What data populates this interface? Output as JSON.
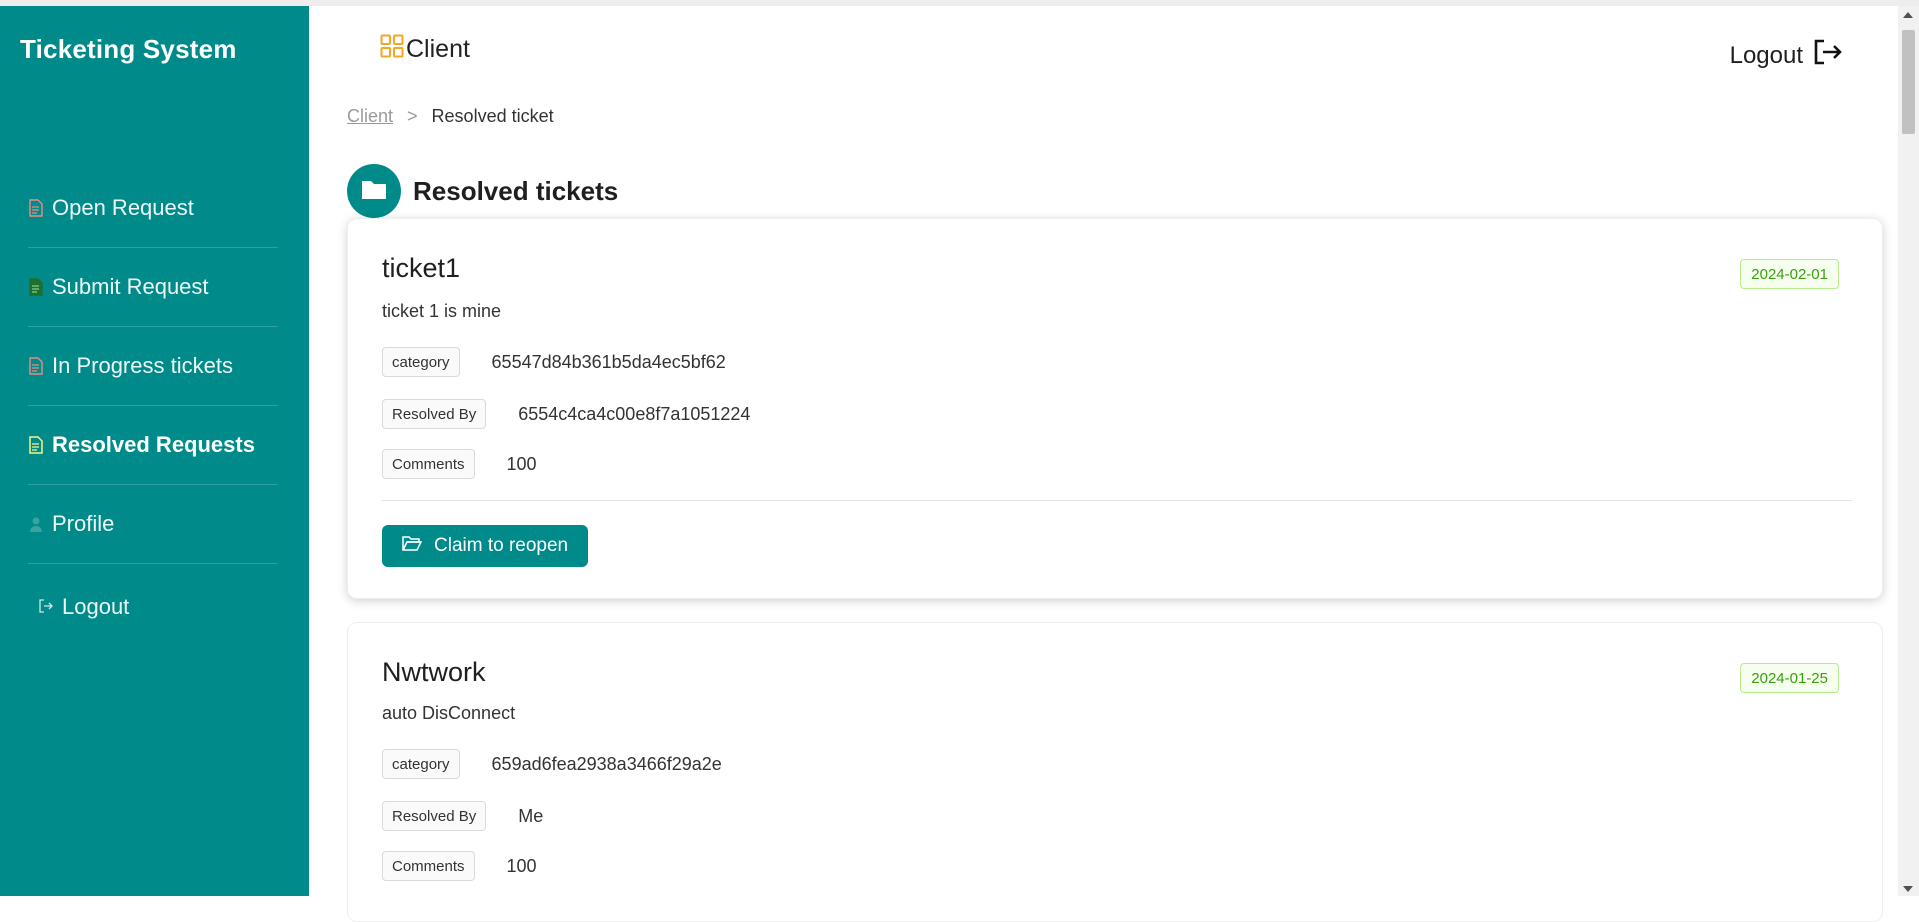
{
  "app": {
    "brand": "Ticketing System"
  },
  "sidebar": {
    "items": [
      {
        "label": "Open Request",
        "icon": "document-icon",
        "icon_color": "#e88b85"
      },
      {
        "label": "Submit Request",
        "icon": "document-icon",
        "icon_color": "#1f6f2e"
      },
      {
        "label": "In Progress tickets",
        "icon": "document-icon",
        "icon_color": "#e88b85"
      },
      {
        "label": "Resolved Requests",
        "icon": "document-icon",
        "icon_color": "#f7f48b",
        "active": true
      },
      {
        "label": "Profile",
        "icon": "user-icon",
        "icon_color": "#3aa3a2"
      }
    ],
    "logout_label": "Logout"
  },
  "header": {
    "role_label": "Client",
    "logout_label": "Logout"
  },
  "breadcrumb": {
    "root": "Client",
    "separator": ">",
    "current": "Resolved ticket"
  },
  "page": {
    "title": "Resolved tickets"
  },
  "tickets": [
    {
      "title": "ticket1",
      "description": "ticket 1 is mine",
      "date": "2024-02-01",
      "category_label": "category",
      "category_value": "65547d84b361b5da4ec5bf62",
      "resolved_by_label": "Resolved By",
      "resolved_by_value": "6554c4ca4c00e8f7a1051224",
      "comments_label": "Comments",
      "comments_value": "100",
      "action_label": "Claim to reopen"
    },
    {
      "title": "Nwtwork",
      "description": "auto DisConnect",
      "date": "2024-01-25",
      "category_label": "category",
      "category_value": "659ad6fea2938a3466f29a2e",
      "resolved_by_label": "Resolved By",
      "resolved_by_value": "Me",
      "comments_label": "Comments",
      "comments_value": "100"
    }
  ],
  "colors": {
    "primary": "#008b8a",
    "accent_orange": "#f5a623",
    "badge_green": "#389e0d"
  }
}
